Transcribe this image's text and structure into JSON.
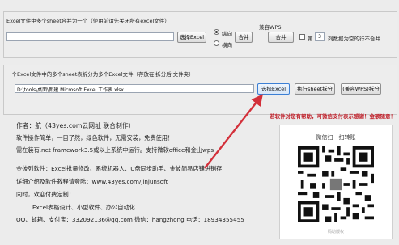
{
  "merge_section": {
    "label": "Excel文件中多个sheet合并为一个（使用前请先关闭所有excel文件）",
    "path_value": "",
    "select_button": "选择Excel",
    "radio_vertical": "纵向",
    "radio_horizontal": "横向",
    "merge_button": "合并",
    "wps_label": "兼容WPS",
    "wps_merge_button": "合并",
    "first_label": "第",
    "rows_value": "3",
    "rows_suffix": "列数据为空的行不合并"
  },
  "split_section": {
    "label": "一个Excel文件中的多个sheet表拆分为多个Excel文件（存放在'拆分后'文件夹）",
    "path_value": "D:\\tools\\桌面\\新建 Microsoft Excel 工作表.xlsx",
    "select_button": "选择Excel",
    "run_button": "执行sheet拆分",
    "wps_button": "(兼容WPS)拆分"
  },
  "info": {
    "author": "作者：航（43yes.com云网址 联合制作）",
    "line2": "软件操作简单，一目了然，绿色软件，无需安装，免费使用！",
    "line3": "需在装有.net framework3.5或以上系统中运行。支持微软office和金山wps",
    "line4": "金彼列软件：Excel批量修改、系统机器人、U盘同步助手、金彼简易店铺进销存",
    "line5": "详细介绍及软件教程请登陆：www.43yes.com/jinjunsoft",
    "line6": "同时，欢迎付费定制：",
    "line7": "Excel表格设计、小型软件、办公自动化",
    "line8": "QQ、邮箱、支付宝：332092136@qq.com    微信：hangzhong    电话：18934355455"
  },
  "donate": {
    "text": "若软件对您有帮助，可微信支付表示感谢！金额随意！",
    "qr_title": "微信扫一扫转账",
    "qr_footer": "码助版权"
  },
  "colors": {
    "arrow": "#d3303a",
    "donate_text": "#c0202a"
  }
}
